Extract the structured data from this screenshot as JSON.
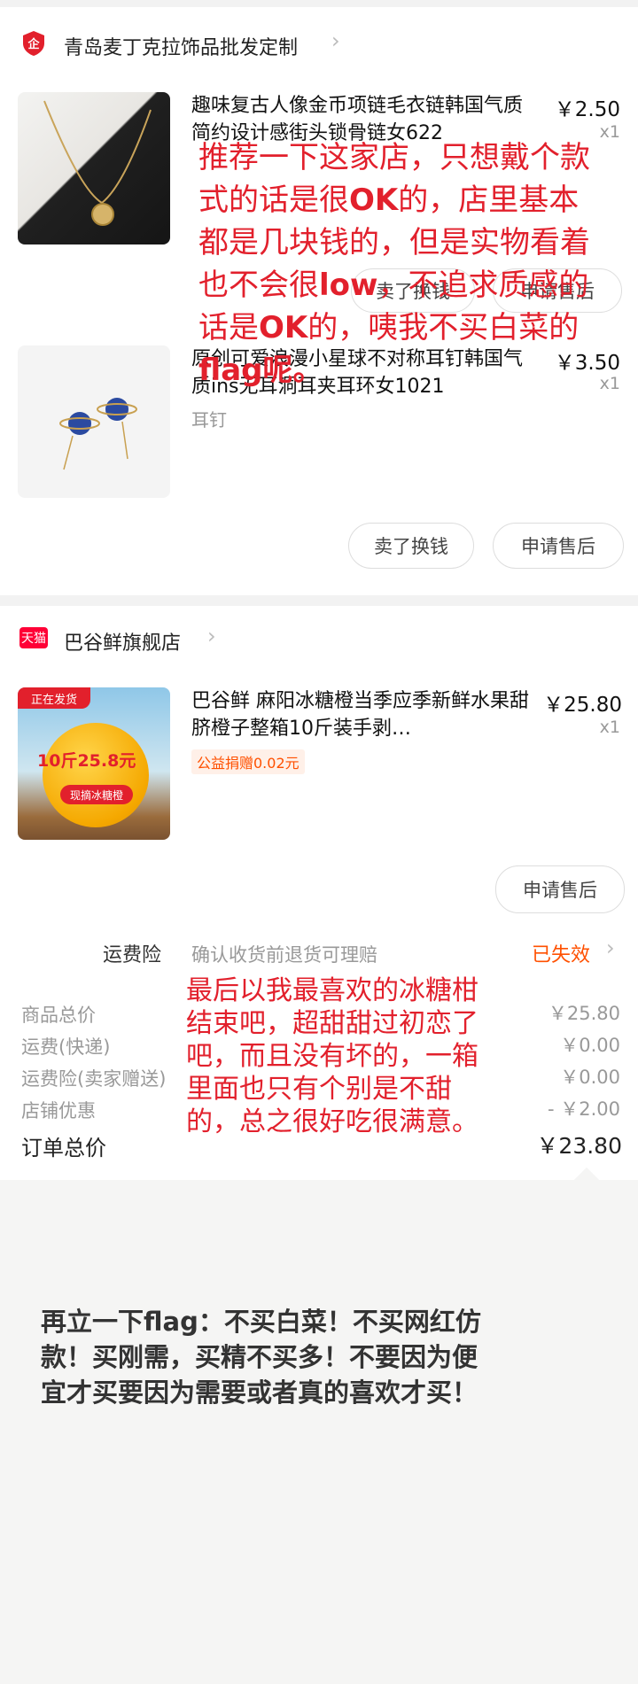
{
  "shop1": {
    "name": "青岛麦丁克拉饰品批发定制",
    "badge_icon": "enterprise-badge-icon",
    "items": [
      {
        "title": "趣味复古人像金币项链毛衣链韩国气质简约设计感街头锁骨链女622",
        "price": "￥2.50",
        "qty": "x1",
        "sku": ""
      },
      {
        "title": "原创可爱浪漫小星球不对称耳钉韩国气质ins无耳洞耳夹耳环女1021",
        "price": "￥3.50",
        "qty": "x1",
        "sku": "耳钉"
      }
    ],
    "btn_sell": "卖了换钱",
    "btn_aftersale": "申请售后"
  },
  "annotation1": {
    "line1": "推荐一下这家店，只想戴个款",
    "line2a": "式的话是很",
    "line2b": "OK",
    "line2c": "的，店里基本",
    "line3": "都是几块钱的，但是实物看着",
    "line4a": "也不会很",
    "line4b": "low",
    "line4c": "，不追求质感的",
    "line5a": "话是",
    "line5b": "OK",
    "line5c": "的，咦我不买白菜的",
    "line6": "flag呢。"
  },
  "shop2": {
    "badge": "天猫",
    "name": "巴谷鲜旗舰店",
    "item": {
      "title": "巴谷鲜 麻阳冰糖橙当季应季新鲜水果甜脐橙子整箱10斤装手剥…",
      "price": "￥25.80",
      "qty": "x1",
      "charity": "公益捐赠0.02元",
      "img_tag": "正在发货",
      "img_price": "10斤25.8元",
      "img_caption": "现摘冰糖橙"
    },
    "btn_aftersale": "申请售后"
  },
  "insurance": {
    "label": "运费险",
    "desc": "确认收货前退货可理赔",
    "status": "已失效"
  },
  "summary": {
    "rows": [
      {
        "label": "商品总价",
        "value": "￥25.80"
      },
      {
        "label": "运费(快递)",
        "value": "￥0.00"
      },
      {
        "label": "运费险(卖家赠送)",
        "value": "￥0.00"
      },
      {
        "label": "店铺优惠",
        "value": "- ￥2.00"
      }
    ],
    "total_label": "订单总价",
    "total_value": "￥23.80"
  },
  "annotation2": {
    "line1": "最后以我最喜欢的冰糖柑",
    "line2": "结束吧，超甜甜过初恋了",
    "line3": "吧，而且没有坏的，一箱",
    "line4": "里面也只有个别是不甜",
    "line5": "的，总之很好吃很满意。"
  },
  "note": {
    "line1": "再立一下flag：不买白菜！不买网红仿",
    "line2": "款！买刚需，买精不买多！不要因为便",
    "line3": "宜才买要因为需要或者真的喜欢才买！"
  },
  "colors": {
    "accent_red": "#e2202c",
    "status_orange": "#ff5000",
    "tmall_red": "#ff0036",
    "charity_bg": "#fff0e8",
    "charity_text": "#ff5000"
  }
}
